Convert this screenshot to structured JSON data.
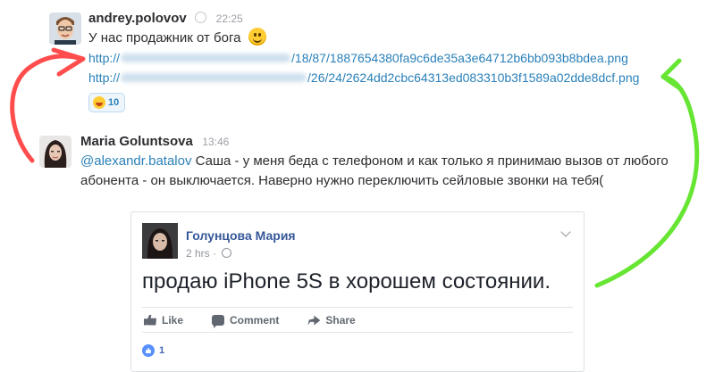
{
  "messages": [
    {
      "username": "andrey.polovov",
      "time": "22:25",
      "text": "У нас продажник от бога",
      "emoji": "smile-emoji",
      "links": [
        {
          "prefix": "http://",
          "suffix": "/18/87/1887654380fa9c6de35a3e64712b6bb093b8bdea.png"
        },
        {
          "prefix": "http://",
          "suffix": "/26/24/2624dd2cbc64313ed083310b3f1589a02dde8dcf.png"
        }
      ],
      "reaction": {
        "emoji": "joy-emoji",
        "count": "10"
      }
    },
    {
      "username": "Maria Goluntsova",
      "time": "13:46",
      "mention": "@alexandr.batalov",
      "text_line1": " Саша  - у меня беда с телефоном и как только я принимаю вызов от любого",
      "text_line2": "абонента - он выключается. Наверно нужно переключить сейловые звонки на тебя("
    }
  ],
  "facebook_post": {
    "author": "Голунцова Мария",
    "time": "2 hrs · ",
    "text": "продаю iPhone 5S в хорошем состоянии.",
    "actions": {
      "like": "Like",
      "comment": "Comment",
      "share": "Share"
    },
    "likes_count": "1"
  },
  "annotation_colors": {
    "red": "#ff4d4d",
    "green": "#66e633"
  }
}
